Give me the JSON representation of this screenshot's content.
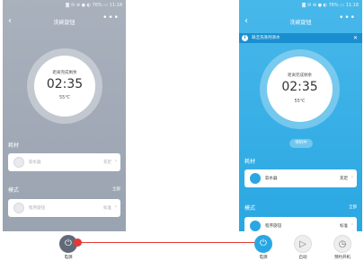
{
  "left_screen": {
    "status": "◙ ✉ ⊕ ● ◐ 76% ▭ 11:18",
    "title": "洗碗旋钮",
    "dial_label": "距离完成剩余",
    "time": "02:35",
    "temp": "55℃",
    "section1": "耗材",
    "card1_title": "软水器",
    "card1_value": "充足",
    "section2": "模式",
    "section2_more": "全部",
    "card2_title": "程序旋钮",
    "card2_value": "标准"
  },
  "right_screen": {
    "status": "◙ ✉ ⊕ ● ◐ 76% ▭ 11:18",
    "title": "洗碗旋钮",
    "banner": "缺乏洗涤剂添水",
    "dial_label": "距离完成剩余",
    "time": "02:35",
    "temp": "55℃",
    "standby": "待机中",
    "section1": "耗材",
    "card1_title": "软水器",
    "card1_value": "充足",
    "section2": "模式",
    "section2_more": "全部",
    "card2_title": "程序旋钮",
    "card2_value": "标准"
  },
  "bottom_bar": {
    "power_label_left": "电源",
    "power_label": "电源",
    "start_label": "启动",
    "schedule_label": "预约开机"
  },
  "colors": {
    "left_bg": "#a1aab6",
    "right_bg": "#39afe6",
    "pointer": "#e53935"
  },
  "icons": [
    "power-icon",
    "play-icon",
    "clock-icon",
    "info-icon",
    "close-icon",
    "chevron-right-icon",
    "back-icon",
    "more-icon"
  ]
}
